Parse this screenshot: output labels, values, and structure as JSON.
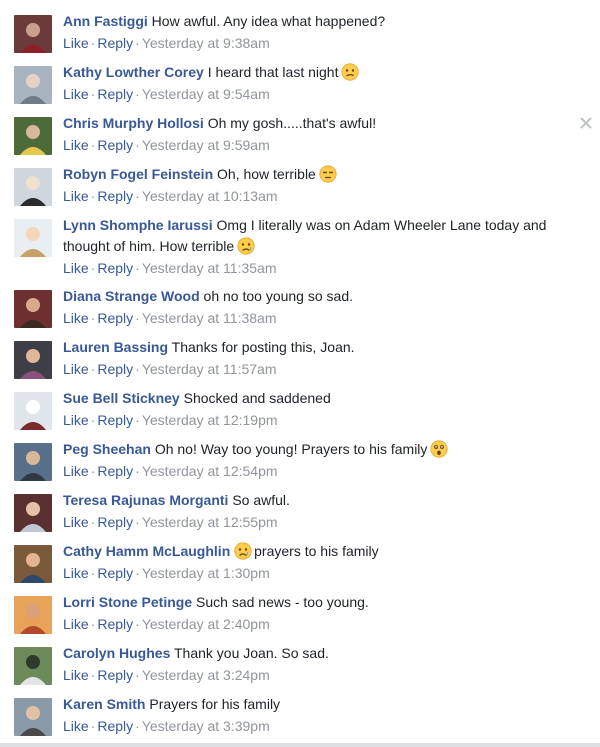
{
  "actions": {
    "like": "Like",
    "reply": "Reply",
    "separator": "·"
  },
  "colors": {
    "author": "#385898",
    "meta": "#90949c",
    "text": "#1d2129"
  },
  "comments": [
    {
      "author": "Ann Fastiggi",
      "text": "How awful. Any idea what happened?",
      "time": "Yesterday at 9:38am",
      "emoji": ""
    },
    {
      "author": "Kathy Lowther Corey",
      "text": "I heard that last night",
      "time": "Yesterday at 9:54am",
      "emoji": "confused-face-icon"
    },
    {
      "author": "Chris Murphy Hollosi",
      "text": "Oh my gosh.....that's awful!",
      "time": "Yesterday at 9:59am",
      "emoji": ""
    },
    {
      "author": "Robyn Fogel Feinstein",
      "text": "Oh, how terrible",
      "time": "Yesterday at 10:13am",
      "emoji": "unamused-face-icon"
    },
    {
      "author": "Lynn Shomphe Iarussi",
      "text": "Omg I literally was on Adam Wheeler Lane today and thought of him. How terrible",
      "time": "Yesterday at 11:35am",
      "emoji": "sad-tear-face-icon"
    },
    {
      "author": "Diana Strange Wood",
      "text": "oh no too young so sad.",
      "time": "Yesterday at 11:38am",
      "emoji": ""
    },
    {
      "author": "Lauren Bassing",
      "text": "Thanks for posting this, Joan.",
      "time": "Yesterday at 11:57am",
      "emoji": ""
    },
    {
      "author": "Sue Bell Stickney",
      "text": "Shocked and saddened",
      "time": "Yesterday at 12:19pm",
      "emoji": ""
    },
    {
      "author": "Peg Sheehan",
      "text": "Oh no! Way too young! Prayers to his family",
      "time": "Yesterday at 12:54pm",
      "emoji": "astonished-face-icon"
    },
    {
      "author": "Teresa Rajunas Morganti",
      "text": "So awful.",
      "time": "Yesterday at 12:55pm",
      "emoji": ""
    },
    {
      "author": "Cathy Hamm McLaughlin",
      "text": "prayers to his family",
      "time": "Yesterday at 1:30pm",
      "emoji": "sad-tear-face-icon",
      "emoji_first": true
    },
    {
      "author": "Lorri Stone Petinge",
      "text": "Such sad news - too young.",
      "time": "Yesterday at 2:40pm",
      "emoji": ""
    },
    {
      "author": "Carolyn Hughes",
      "text": "Thank you Joan. So sad.",
      "time": "Yesterday at 3:24pm",
      "emoji": ""
    },
    {
      "author": "Karen Smith",
      "text": "Prayers for his family",
      "time": "Yesterday at 3:39pm",
      "emoji": ""
    }
  ]
}
